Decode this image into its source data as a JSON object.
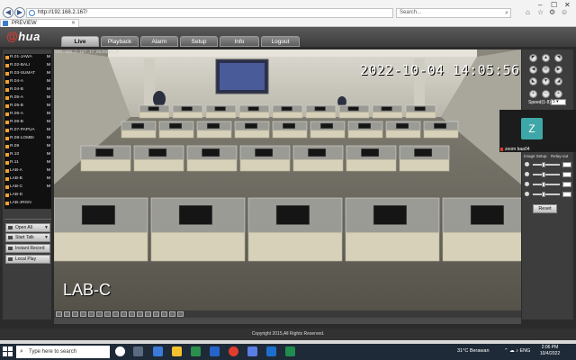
{
  "browser": {
    "address": "http://192.168.2.167/",
    "search_placeholder": "Search...",
    "tab_title": "PREVIEW",
    "back_glyph": "◀",
    "forward_glyph": "▶",
    "search_glyph": "⌕",
    "tab_close_glyph": "✕",
    "window_controls": [
      "–",
      "☐",
      "✕"
    ],
    "toolbar_glyphs": [
      "⌂",
      "☆",
      "⚙",
      "☺"
    ]
  },
  "app": {
    "logo_main": "@",
    "logo_rest": "hua",
    "menu": [
      "Live",
      "Playback",
      "Alarm",
      "Setup",
      "Info",
      "Logout"
    ],
    "active_menu": "Live",
    "footer": "Copyright 2015,All Rights Reserved."
  },
  "camera_list": [
    {
      "label": "R.01-JAWA",
      "mark": "M"
    },
    {
      "label": "R.02-BALI",
      "mark": "M"
    },
    {
      "label": "R.03-SUMAT",
      "mark": "M"
    },
    {
      "label": "R.04-A",
      "mark": "M"
    },
    {
      "label": "R.04-B",
      "mark": "M"
    },
    {
      "label": "R.05-A",
      "mark": "M"
    },
    {
      "label": "R.05-B",
      "mark": "M"
    },
    {
      "label": "R.06-A",
      "mark": "M"
    },
    {
      "label": "R.06-B",
      "mark": "M"
    },
    {
      "label": "R.07-PAPUA",
      "mark": "M"
    },
    {
      "label": "R.08-LOMBI",
      "mark": "M"
    },
    {
      "label": "R.09",
      "mark": "M"
    },
    {
      "label": "R.10",
      "mark": "M"
    },
    {
      "label": "R.11",
      "mark": "M"
    },
    {
      "label": "LAB-A",
      "mark": "M"
    },
    {
      "label": "LAB-B",
      "mark": "M"
    },
    {
      "label": "LAB-C",
      "mark": "M"
    },
    {
      "label": "LAB-D",
      "mark": ""
    },
    {
      "label": "LAB-JRGN",
      "mark": ""
    }
  ],
  "side_buttons": {
    "open_all": "Open All",
    "start_talk": "Start Talk",
    "instant_record": "Instant Record",
    "local_play": "Local Play"
  },
  "video": {
    "info": "192.168.2.167_17_862Kbps_M",
    "timestamp": "2022-10-04 14:05:56",
    "camera_name": "LAB-C"
  },
  "ptz": {
    "speed_label": "Speed(1-8)",
    "speed_value": "5",
    "arrows": [
      "◤",
      "▲",
      "◥",
      "◀",
      "⊙",
      "▶",
      "◣",
      "▼",
      "◢"
    ],
    "extra_buttons": [
      "+",
      "−",
      "+",
      "−",
      "+",
      "−"
    ],
    "image_setup_tab": "Image Setup",
    "relay_out_tab": "Relay-out",
    "reset": "Reset"
  },
  "zoom_overlay": {
    "initial": "Z",
    "name": "zoom baa04",
    "avatar_color": "#3fa7a8"
  },
  "taskbar": {
    "search_placeholder": "Type here to search",
    "weather": "31°C  Berawan",
    "time": "2:06 PM",
    "date": "10/4/2022",
    "tray_glyph": "⌃ ☁ ♪ ENG"
  },
  "colors": {
    "accent_red": "#e03a2f",
    "camera_icon": "#f2a22a",
    "taskbar": "#1f2a38"
  }
}
